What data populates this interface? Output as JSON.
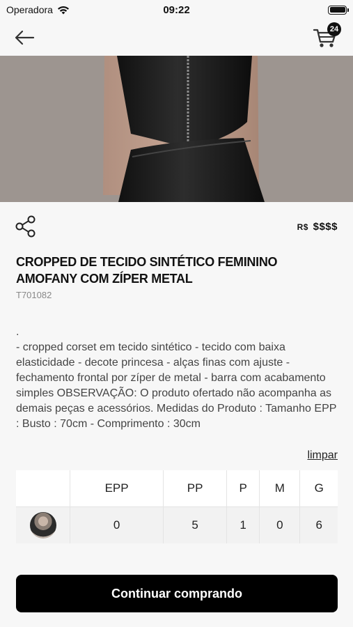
{
  "status_bar": {
    "carrier": "Operadora",
    "time": "09:22"
  },
  "header": {
    "back_icon": "arrow-left-icon",
    "cart_icon": "cart-icon",
    "cart_count": "24"
  },
  "gallery": {
    "slide_count": 6,
    "active_index": 0
  },
  "product": {
    "share_icon": "share-icon",
    "currency": "R$",
    "price": "$$$$",
    "title": "CROPPED DE TECIDO SINTÉTICO FEMININO AMOFANY COM ZÍPER METAL",
    "sku": "T701082",
    "description": ".\n- cropped corset em tecido sintético - tecido com baixa elasticidade - decote princesa - alças finas com ajuste - fechamento frontal por zíper de metal - barra com acabamento simples OBSERVAÇÃO: O produto ofertado não acompanha as demais peças e acessórios. Medidas do Produto : Tamanho EPP : Busto : 70cm - Comprimento : 30cm"
  },
  "sizes": {
    "clear_label": "limpar",
    "headers": [
      "EPP",
      "PP",
      "P",
      "M",
      "G"
    ],
    "quantities": [
      "0",
      "5",
      "1",
      "0",
      "6"
    ]
  },
  "footer": {
    "continue_label": "Continuar comprando"
  },
  "colors": {
    "primary": "#000000",
    "background": "#f7f7f7"
  }
}
